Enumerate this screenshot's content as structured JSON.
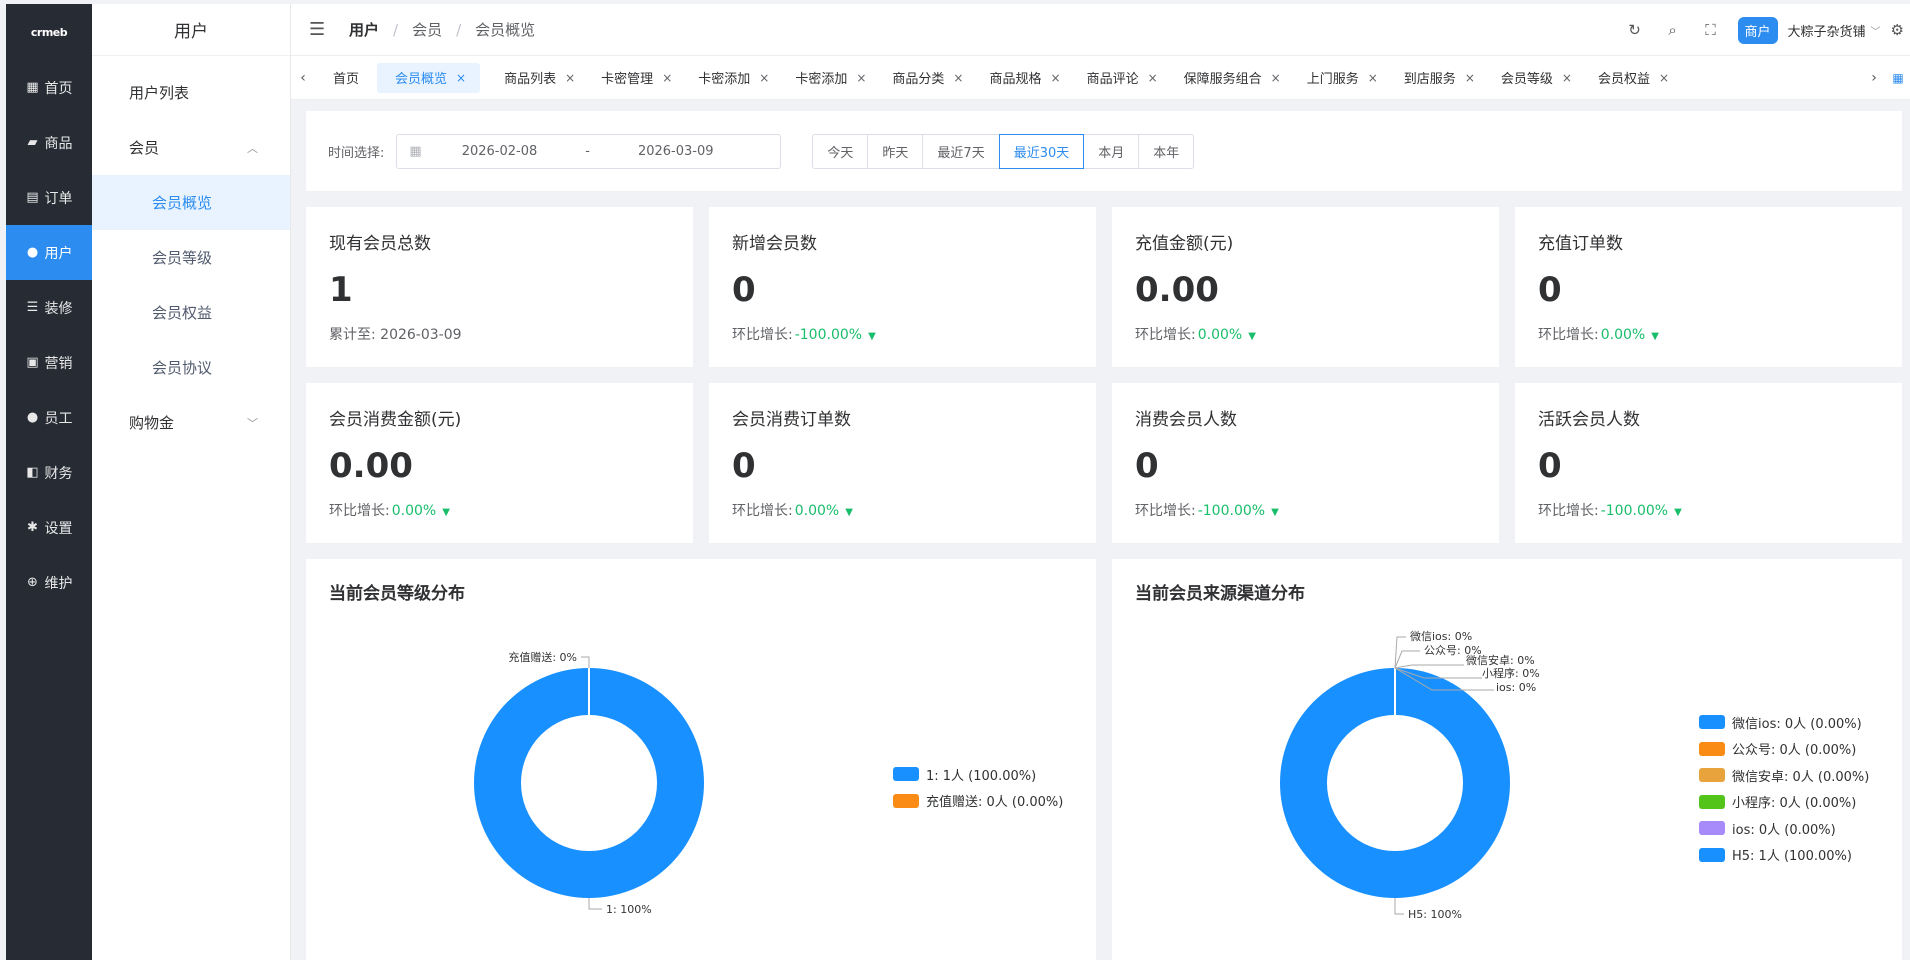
{
  "logo": {
    "text": "crmeb"
  },
  "nav": {
    "items": [
      {
        "label": "首页",
        "icon": "grid-icon"
      },
      {
        "label": "商品",
        "icon": "bag-icon"
      },
      {
        "label": "订单",
        "icon": "clipboard-icon"
      },
      {
        "label": "用户",
        "icon": "user-icon"
      },
      {
        "label": "装修",
        "icon": "sliders-icon"
      },
      {
        "label": "营销",
        "icon": "store-icon"
      },
      {
        "label": "员工",
        "icon": "person-icon"
      },
      {
        "label": "财务",
        "icon": "wallet-icon"
      },
      {
        "label": "设置",
        "icon": "gear-icon"
      },
      {
        "label": "维护",
        "icon": "plus-circle-icon"
      }
    ]
  },
  "subnav": {
    "title": "用户",
    "user_list": "用户列表",
    "member": "会员",
    "children": [
      "会员概览",
      "会员等级",
      "会员权益",
      "会员协议"
    ],
    "shopping_gold": "购物金"
  },
  "header": {
    "breadcrumb": [
      "用户",
      "会员",
      "会员概览"
    ],
    "shop_badge": "商户",
    "shop_name": "大粽子杂货铺"
  },
  "tabs": [
    "首页",
    "会员概览",
    "商品列表",
    "卡密管理",
    "卡密添加",
    "卡密添加",
    "商品分类",
    "商品规格",
    "商品评论",
    "保障服务组合",
    "上门服务",
    "到店服务",
    "会员等级",
    "会员权益"
  ],
  "filter": {
    "label": "时间选择:",
    "start": "2026-02-08",
    "dash": "-",
    "end": "2026-03-09",
    "ranges": [
      "今天",
      "昨天",
      "最近7天",
      "最近30天",
      "本月",
      "本年"
    ],
    "active": "最近30天"
  },
  "stats": [
    {
      "title": "现有会员总数",
      "value": "1",
      "sub_label": "累计至:",
      "sub_value": "2026-03-09"
    },
    {
      "title": "新增会员数",
      "value": "0",
      "sub_label": "环比增长:",
      "sub_value": "-100.00%"
    },
    {
      "title": "充值金额(元)",
      "value": "0.00",
      "sub_label": "环比增长:",
      "sub_value": "0.00%"
    },
    {
      "title": "充值订单数",
      "value": "0",
      "sub_label": "环比增长:",
      "sub_value": "0.00%"
    },
    {
      "title": "会员消费金额(元)",
      "value": "0.00",
      "sub_label": "环比增长:",
      "sub_value": "0.00%"
    },
    {
      "title": "会员消费订单数",
      "value": "0",
      "sub_label": "环比增长:",
      "sub_value": "0.00%"
    },
    {
      "title": "消费会员人数",
      "value": "0",
      "sub_label": "环比增长:",
      "sub_value": "-100.00%"
    },
    {
      "title": "活跃会员人数",
      "value": "0",
      "sub_label": "环比增长:",
      "sub_value": "-100.00%"
    }
  ],
  "chart_data": [
    {
      "type": "pie",
      "title": "当前会员等级分布",
      "categories": [
        "1",
        "充值赠送"
      ],
      "values": [
        1,
        0
      ],
      "outer_labels": [
        "1: 100%",
        "充值赠送: 0%"
      ],
      "legend": [
        "1: 1人 (100.00%)",
        "充值赠送: 0人 (0.00%)"
      ],
      "colors": [
        "#1890ff",
        "#fa8c16"
      ],
      "legend_position": "right"
    },
    {
      "type": "pie",
      "title": "当前会员来源渠道分布",
      "categories": [
        "微信ios",
        "公众号",
        "微信安卓",
        "小程序",
        "ios",
        "H5"
      ],
      "values": [
        0,
        0,
        0,
        0,
        0,
        1
      ],
      "outer_labels": [
        "微信ios: 0%",
        "公众号: 0%",
        "微信安卓: 0%",
        "小程序: 0%",
        "ios: 0%",
        "H5: 100%"
      ],
      "legend": [
        "微信ios: 0人 (0.00%)",
        "公众号: 0人 (0.00%)",
        "微信安卓: 0人 (0.00%)",
        "小程序: 0人 (0.00%)",
        "ios: 0人 (0.00%)",
        "H5: 1人 (100.00%)"
      ],
      "colors": [
        "#1890ff",
        "#fa8c16",
        "#e8a33d",
        "#52c41a",
        "#a78bfa",
        "#1890ff"
      ],
      "legend_position": "right"
    }
  ]
}
